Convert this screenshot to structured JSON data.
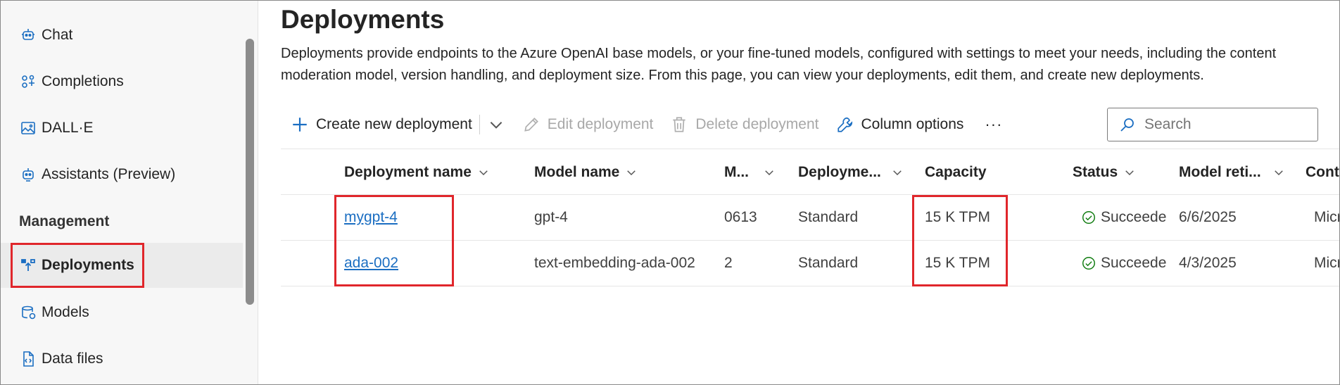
{
  "sidebar": {
    "items": [
      {
        "label": "Chat",
        "icon": "chat-bot-icon"
      },
      {
        "label": "Completions",
        "icon": "completions-icon"
      },
      {
        "label": "DALL·E",
        "icon": "image-icon"
      },
      {
        "label": "Assistants (Preview)",
        "icon": "assistant-bot-icon"
      },
      {
        "label": "Deployments",
        "icon": "deployments-icon",
        "selected": true
      },
      {
        "label": "Models",
        "icon": "models-icon"
      },
      {
        "label": "Data files",
        "icon": "data-file-icon"
      }
    ],
    "section_label": "Management"
  },
  "page": {
    "title": "Deployments",
    "description": "Deployments provide endpoints to the Azure OpenAI base models, or your fine-tuned models, configured with settings to meet your needs, including the content moderation model, version handling, and deployment size. From this page, you can view your deployments, edit them, and create new deployments."
  },
  "toolbar": {
    "create_label": "Create new deployment",
    "edit_label": "Edit deployment",
    "delete_label": "Delete deployment",
    "column_options_label": "Column options",
    "more_label": "···",
    "search_placeholder": "Search"
  },
  "table": {
    "columns": [
      "Deployment name",
      "Model name",
      "M...",
      "Deployme...",
      "Capacity",
      "Status",
      "Model reti...",
      "Conte"
    ],
    "rows": [
      {
        "deployment_name": "mygpt-4",
        "model_name": "gpt-4",
        "model_version": "0613",
        "deployment_type": "Standard",
        "capacity": "15 K TPM",
        "status": "Succeede",
        "model_retirement": "6/6/2025",
        "content_filter": "Micro"
      },
      {
        "deployment_name": "ada-002",
        "model_name": "text-embedding-ada-002",
        "model_version": "2",
        "deployment_type": "Standard",
        "capacity": "15 K TPM",
        "status": "Succeede",
        "model_retirement": "4/3/2025",
        "content_filter": "Micro"
      }
    ]
  },
  "colors": {
    "accent": "#1b6ec2",
    "highlight": "#e0262b",
    "success": "#107c10"
  }
}
